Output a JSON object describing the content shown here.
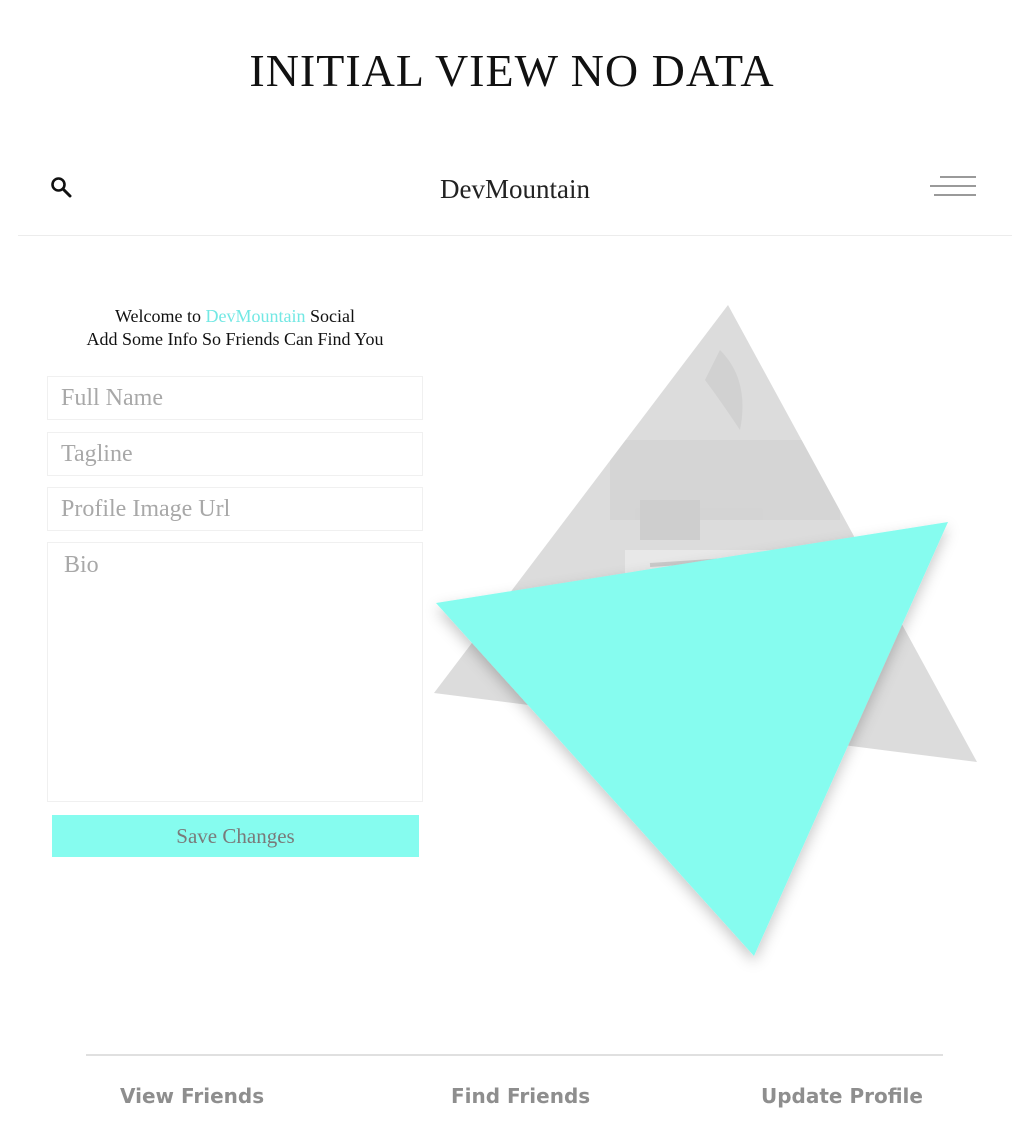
{
  "page_title": "INITIAL VIEW NO DATA",
  "header": {
    "search_icon": "search-icon",
    "brand": "DevMountain",
    "menu_icon": "hamburger-menu-icon"
  },
  "welcome": {
    "prefix": "Welcome to",
    "brand": "DevMountain",
    "suffix": "Social",
    "line2": "Add Some Info So Friends Can Find You"
  },
  "form": {
    "full_name": {
      "value": "",
      "placeholder": "Full Name"
    },
    "tagline": {
      "value": "",
      "placeholder": "Tagline"
    },
    "profile_image_url": {
      "value": "",
      "placeholder": "Profile Image Url"
    },
    "bio": {
      "value": "",
      "placeholder": "Bio"
    },
    "save_label": "Save Changes"
  },
  "footer": {
    "links": [
      "View Friends",
      "Find Friends",
      "Update Profile"
    ]
  },
  "colors": {
    "accent": "#86fcef",
    "accent_text": "#73e8e4",
    "gray_triangle": "#dcdcdc",
    "footer_text": "#8e8e8e"
  }
}
